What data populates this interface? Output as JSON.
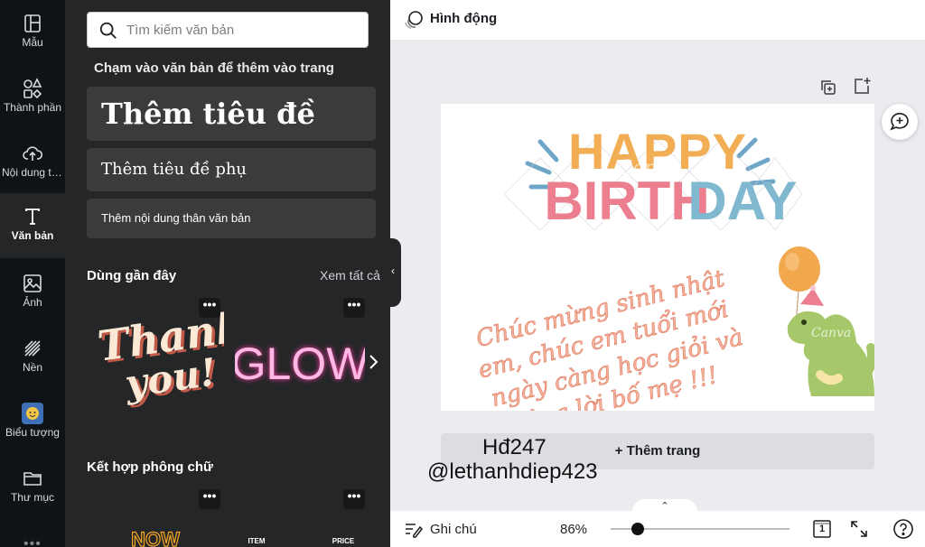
{
  "rail": {
    "items": [
      {
        "label": "Mẫu",
        "icon": "template-icon"
      },
      {
        "label": "Thành phần",
        "icon": "elements-icon"
      },
      {
        "label": "Nội dung tải lên",
        "icon": "upload-cloud-icon"
      },
      {
        "label": "Văn bản",
        "icon": "text-icon"
      },
      {
        "label": "Ảnh",
        "icon": "image-icon"
      },
      {
        "label": "Nền",
        "icon": "background-icon"
      },
      {
        "label": "Biểu tượng",
        "icon": "emoji-icon"
      },
      {
        "label": "Thư mục",
        "icon": "folder-icon"
      }
    ]
  },
  "panel": {
    "search_placeholder": "Tìm kiếm văn bản",
    "hint": "Chạm vào văn bản để thêm vào trang",
    "add_heading": "Thêm tiêu đề",
    "add_subheading": "Thêm tiêu đề phụ",
    "add_body": "Thêm nội dung thân văn bản",
    "recent_title": "Dùng gần đây",
    "see_all": "Xem tất cả",
    "recent": [
      {
        "line1": "Thank",
        "line2": "you!"
      },
      {
        "line1": "GLOW"
      }
    ],
    "combo_title": "Kết hợp phông chữ",
    "combos": [
      {
        "text": "NOW"
      },
      {
        "text": "ITEM"
      },
      {
        "text": "PRICE"
      }
    ],
    "more_label": "•••"
  },
  "topbar": {
    "animate_label": "Hình động"
  },
  "page": {
    "happy": "HAPPY",
    "birth": "BIRTH",
    "day": "DAY",
    "watermark": "Canva",
    "wish_lines": [
      "Chúc mừng sinh nhật",
      "em, chúc em tuổi mới",
      "ngày càng học giỏi và",
      "vâng lời bố mẹ !!!"
    ]
  },
  "add_page_label": "+ Thêm trang",
  "overlay": {
    "line1": "Hđ247",
    "line2": "@lethanhdiep423"
  },
  "bottombar": {
    "notes_label": "Ghi chú",
    "zoom": "86%",
    "zoom_value_pct": 86,
    "page_count": "1"
  },
  "colors": {
    "rail_bg": "#0e1318",
    "panel_bg": "#252627",
    "happy": "#f1ae55",
    "birth": "#ec7f8f",
    "day": "#7fb8cf",
    "wish": "#f5b39c"
  }
}
